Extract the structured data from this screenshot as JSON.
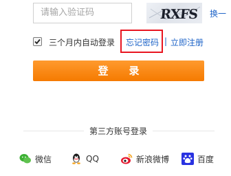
{
  "captcha": {
    "placeholder": "请输入验证码",
    "image_text": "RXFS",
    "refresh_label": "换一"
  },
  "remember": {
    "checked": true,
    "label": "三个月内自动登录"
  },
  "links": {
    "forgot": "忘记密码",
    "divider": "|",
    "register": "立即注册"
  },
  "login_button": {
    "label": "登录",
    "color": "#f57a00"
  },
  "third_party": {
    "title": "第三方账号登录",
    "providers": [
      {
        "label": "微信",
        "icon": "wechat-icon"
      },
      {
        "label": "QQ",
        "icon": "qq-icon"
      },
      {
        "label": "新浪微博",
        "icon": "weibo-icon"
      },
      {
        "label": "百度",
        "icon": "baidu-icon"
      }
    ]
  }
}
